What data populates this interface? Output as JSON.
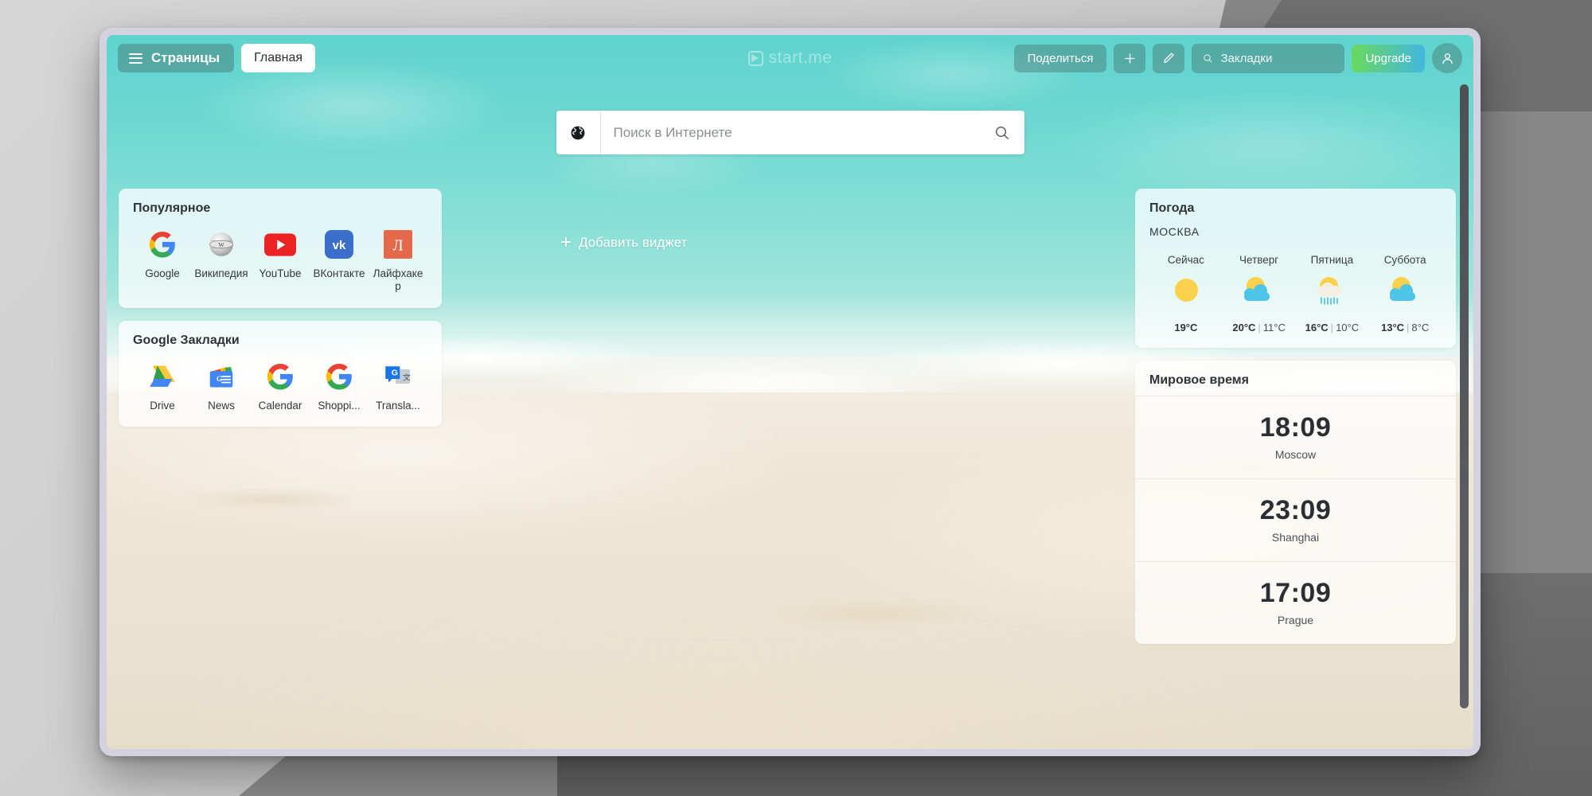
{
  "header": {
    "pages_label": "Страницы",
    "active_tab": "Главная",
    "brand": "start.me",
    "share_label": "Поделиться",
    "add_label": "+",
    "edit_label": "",
    "bookmarks_placeholder": "Закладки",
    "upgrade_label": "Upgrade"
  },
  "websearch": {
    "placeholder": "Поиск в Интернете",
    "value": ""
  },
  "add_widget": {
    "label": "Добавить виджет",
    "plus": "+"
  },
  "widgets": {
    "popular": {
      "title": "Популярное",
      "links": [
        {
          "label": "Google",
          "icon": "google-icon"
        },
        {
          "label": "Википедия",
          "icon": "wikipedia-icon"
        },
        {
          "label": "YouTube",
          "icon": "youtube-icon"
        },
        {
          "label": "ВКонтакте",
          "icon": "vk-icon"
        },
        {
          "label": "Лайфхакер",
          "icon": "lifehacker-icon"
        }
      ]
    },
    "google_bookmarks": {
      "title": "Google Закладки",
      "links": [
        {
          "label": "Drive",
          "icon": "google-drive-icon"
        },
        {
          "label": "News",
          "icon": "google-news-icon"
        },
        {
          "label": "Calendar",
          "icon": "google-calendar-icon"
        },
        {
          "label": "Shoppi...",
          "icon": "google-shopping-icon"
        },
        {
          "label": "Transla...",
          "icon": "google-translate-icon"
        }
      ]
    },
    "weather": {
      "title": "Погода",
      "city": "МОСКВА",
      "days": [
        {
          "name": "Сейчас",
          "icon": "sunny-icon",
          "high": "19°C",
          "sep": "",
          "low": ""
        },
        {
          "name": "Четверг",
          "icon": "partly-cloudy-icon",
          "high": "20°C",
          "sep": "|",
          "low": "11°C"
        },
        {
          "name": "Пятница",
          "icon": "rain-showers-icon",
          "high": "16°C",
          "sep": "|",
          "low": "10°C"
        },
        {
          "name": "Суббота",
          "icon": "partly-cloudy-icon",
          "high": "13°C",
          "sep": "|",
          "low": "8°C"
        }
      ]
    },
    "world_time": {
      "title": "Мировое время",
      "clocks": [
        {
          "time": "18:09",
          "zone": "Moscow"
        },
        {
          "time": "23:09",
          "zone": "Shanghai"
        },
        {
          "time": "17:09",
          "zone": "Prague"
        }
      ]
    }
  },
  "colors": {
    "upgrade_gradient_start": "#6ad85e",
    "upgrade_gradient_end": "#43b7e0",
    "sea": "#6ed8d2",
    "sand": "#ece4d2",
    "sun": "#fbd14b",
    "cloud": "#4dc4e8",
    "window_frame": "#d3d2de"
  }
}
